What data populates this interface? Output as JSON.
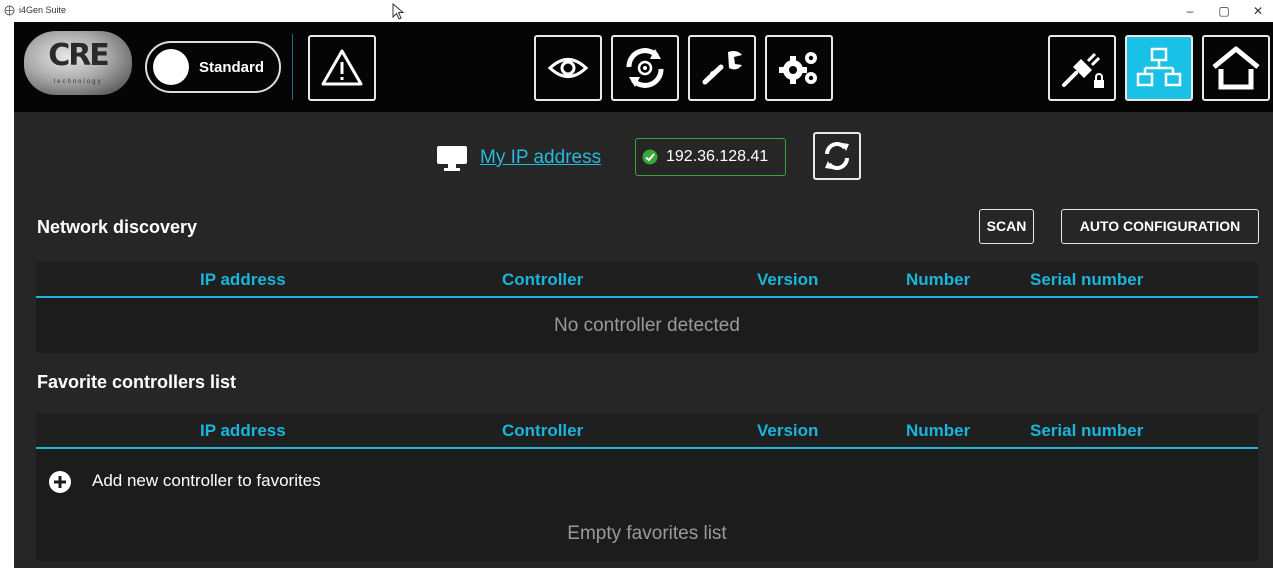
{
  "window": {
    "title": "i4Gen Suite",
    "minimize": "–",
    "maximize": "▢",
    "close": "✕"
  },
  "toolbar": {
    "logo_text": "CRE",
    "logo_subtext": "technology",
    "mode_label": "Standard",
    "buttons": [
      {
        "name": "warning",
        "icon": "warning-triangle-icon"
      },
      {
        "name": "monitor",
        "icon": "eye-icon"
      },
      {
        "name": "sync",
        "icon": "sync-icon"
      },
      {
        "name": "tools",
        "icon": "wrench-icon"
      },
      {
        "name": "settings",
        "icon": "gears-icon"
      },
      {
        "name": "connection",
        "icon": "plug-lock-icon"
      },
      {
        "name": "network",
        "icon": "network-icon",
        "active": true
      },
      {
        "name": "home",
        "icon": "home-icon"
      }
    ],
    "active_color": "#19c1e6"
  },
  "ip_bar": {
    "link_label": "My IP address",
    "ip_value": "192.36.128.41",
    "status_color": "#3aa53a"
  },
  "network_discovery": {
    "title": "Network discovery",
    "scan_label": "SCAN",
    "auto_config_label": "AUTO CONFIGURATION",
    "columns": [
      "IP address",
      "Controller",
      "Version",
      "Number",
      "Serial number"
    ],
    "empty_message": "No controller detected"
  },
  "favorites": {
    "title": "Favorite controllers list",
    "columns": [
      "IP address",
      "Controller",
      "Version",
      "Number",
      "Serial number"
    ],
    "add_label": "Add new controller to favorites",
    "empty_message": "Empty favorites list"
  },
  "colors": {
    "accent": "#19b5da",
    "background": "#262626",
    "toolbar": "#050505"
  }
}
